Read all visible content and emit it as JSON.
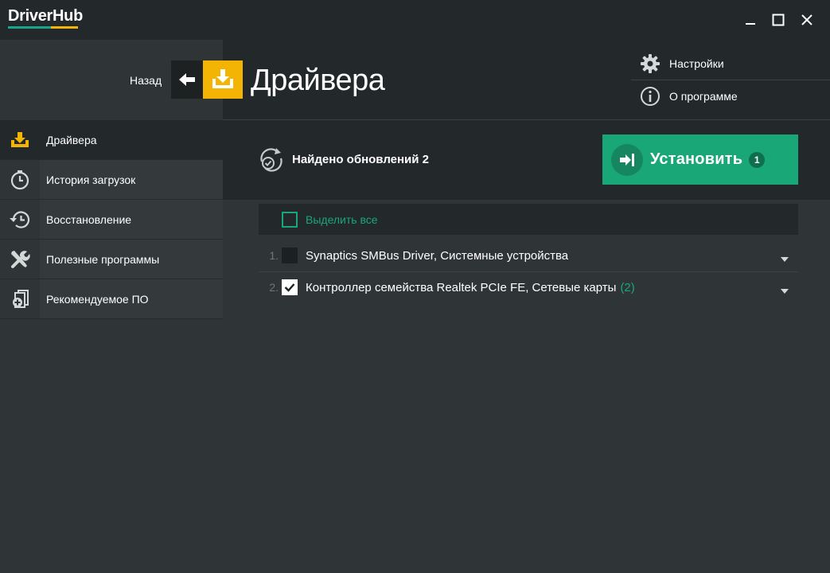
{
  "app": {
    "name": "DriverHub",
    "brand_colors": {
      "green": "#1aa58a",
      "yellow": "#f3b404"
    }
  },
  "header": {
    "back_label": "Назад",
    "page_title": "Драйвера",
    "menu": [
      {
        "label": "Настройки",
        "icon": "gear-icon"
      },
      {
        "label": "О программе",
        "icon": "info-icon"
      }
    ]
  },
  "sidebar": {
    "items": [
      {
        "label": "Драйвера",
        "icon": "driver-download-icon",
        "active": true
      },
      {
        "label": "История загрузок",
        "icon": "clock-icon",
        "active": false
      },
      {
        "label": "Восстановление",
        "icon": "restore-history-icon",
        "active": false
      },
      {
        "label": "Полезные программы",
        "icon": "tools-icon",
        "active": false
      },
      {
        "label": "Рекомендуемое ПО",
        "icon": "recommended-apps-icon",
        "active": false
      }
    ]
  },
  "status": {
    "text": "Найдено обновлений 2",
    "icon": "refresh-check-icon"
  },
  "install_button": {
    "label": "Установить",
    "badge": "1",
    "color": "#1aa777"
  },
  "list": {
    "select_all_label": "Выделить все",
    "rows": [
      {
        "num": "1.",
        "name": "Synaptics SMBus Driver, Системные устройства",
        "count": "",
        "checked": false
      },
      {
        "num": "2.",
        "name": "Контроллер семейства Realtek PCIe FE, Сетевые карты",
        "count": "(2)",
        "checked": true
      }
    ]
  }
}
